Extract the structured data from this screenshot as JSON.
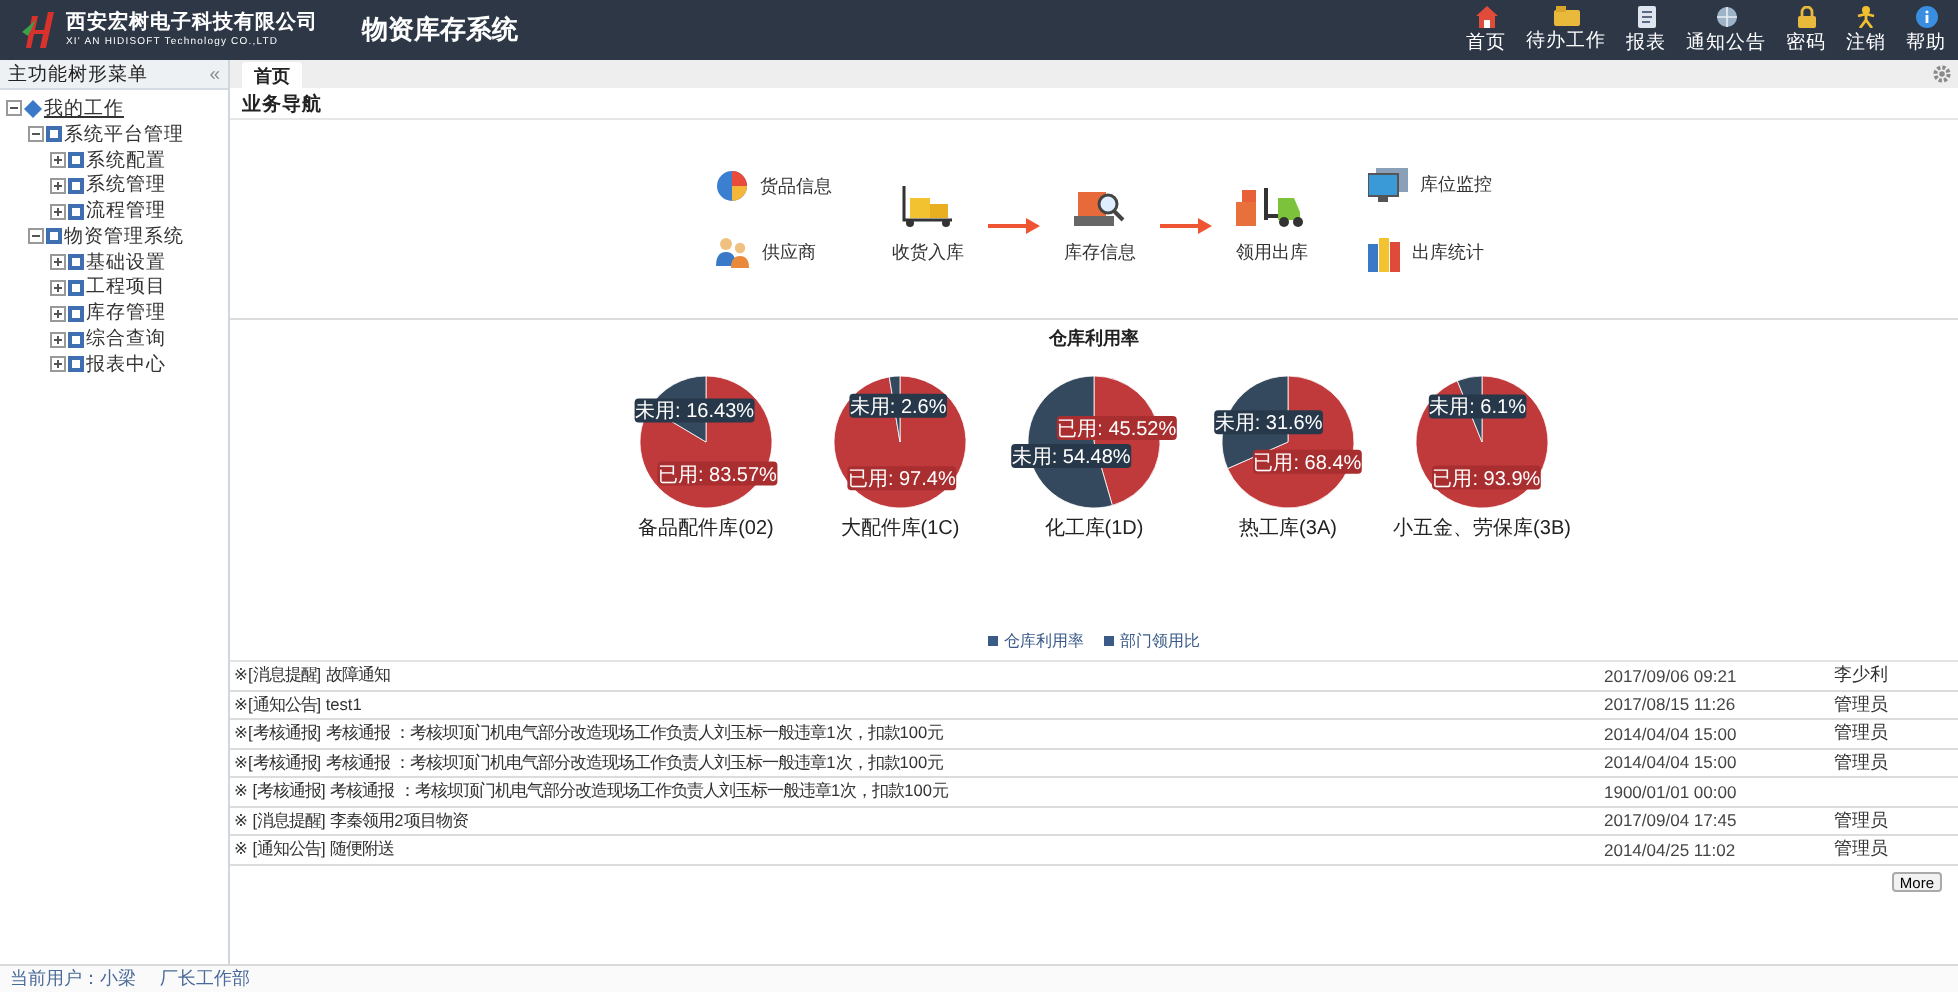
{
  "header": {
    "company": "西安宏树电子科技有限公司",
    "company_en": "XI' AN HIDISOFT Technology CO.,LTD",
    "system_title": "物资库存系统",
    "nav": [
      "首页",
      "待办工作",
      "报表",
      "通知公告",
      "密码",
      "注销",
      "帮助"
    ]
  },
  "sidebar": {
    "title": "主功能树形菜单",
    "collapse": "«",
    "tree": [
      {
        "label": "我的工作",
        "expanded": true,
        "children": [
          {
            "label": "系统平台管理",
            "expanded": true,
            "children": [
              {
                "label": "系统配置",
                "expanded": false
              },
              {
                "label": "系统管理",
                "expanded": false
              },
              {
                "label": "流程管理",
                "expanded": false
              }
            ]
          },
          {
            "label": "物资管理系统",
            "expanded": true,
            "children": [
              {
                "label": "基础设置",
                "expanded": false
              },
              {
                "label": "工程项目",
                "expanded": false
              },
              {
                "label": "库存管理",
                "expanded": false
              },
              {
                "label": "综合查询",
                "expanded": false
              },
              {
                "label": "报表中心",
                "expanded": false
              }
            ]
          }
        ]
      }
    ]
  },
  "tabs": [
    {
      "label": "首页",
      "selected": true
    }
  ],
  "business_nav": {
    "title": "业务导航",
    "left": [
      "货品信息",
      "供应商"
    ],
    "flow": [
      "收货入库",
      "库存信息",
      "领用出库"
    ],
    "right": [
      "库位监控",
      "出库统计"
    ]
  },
  "utilization": {
    "title": "仓库利用率",
    "pies": [
      {
        "chart_data": {
          "type": "pie",
          "title": "备品配件库(02)",
          "values": [
            83.57,
            16.43
          ],
          "value_labels": [
            "已用: 83.57%",
            "未用: 16.43%"
          ]
        }
      },
      {
        "chart_data": {
          "type": "pie",
          "title": "大配件库(1C)",
          "values": [
            97.4,
            2.6
          ],
          "value_labels": [
            "已用: 97.4%",
            "未用: 2.6%"
          ]
        }
      },
      {
        "chart_data": {
          "type": "pie",
          "title": "化工库(1D)",
          "values": [
            45.52,
            54.48
          ],
          "value_labels": [
            "已用: 45.52%",
            "未用: 54.48%"
          ]
        }
      },
      {
        "chart_data": {
          "type": "pie",
          "title": "热工库(3A)",
          "values": [
            68.4,
            31.6
          ],
          "value_labels": [
            "已用: 68.4%",
            "未用: 31.6%"
          ]
        }
      },
      {
        "chart_data": {
          "type": "pie",
          "title": "小五金、劳保库(3B)",
          "values": [
            93.9,
            6.1
          ],
          "value_labels": [
            "已用: 93.9%",
            "未用: 6.1%"
          ]
        }
      }
    ],
    "legend": [
      {
        "label": "仓库利用率",
        "selected": true
      },
      {
        "label": "部门领用比",
        "selected": true
      }
    ]
  },
  "messages": {
    "rows": [
      {
        "text": "※[消息提醒] 故障通知",
        "time": "2017/09/06 09:21",
        "user": "李少利"
      },
      {
        "text": "※[通知公告] test1",
        "time": "2017/08/15 11:26",
        "user": "管理员"
      },
      {
        "text": "※[考核通报] 考核通报 ：考核坝顶门机电气部分改造现场工作负责人刘玉标一般违章1次，扣款100元",
        "time": "2014/04/04 15:00",
        "user": "管理员"
      },
      {
        "text": "※[考核通报] 考核通报 ：考核坝顶门机电气部分改造现场工作负责人刘玉标一般违章1次，扣款100元",
        "time": "2014/04/04 15:00",
        "user": "管理员"
      },
      {
        "text": "※ [考核通报] 考核通报 ：考核坝顶门机电气部分改造现场工作负责人刘玉标一般违章1次，扣款100元",
        "time": "1900/01/01 00:00"
      },
      {
        "text": "※ [消息提醒] 李秦领用2项目物资",
        "time": "2017/09/04 17:45",
        "user": "管理员"
      },
      {
        "text": "※ [通知公告] 随便附送",
        "time": "2014/04/25 11:02",
        "user": "管理员"
      }
    ],
    "more": "More"
  },
  "footer": {
    "user": "当前用户：小梁",
    "department": "厂长工作部"
  }
}
